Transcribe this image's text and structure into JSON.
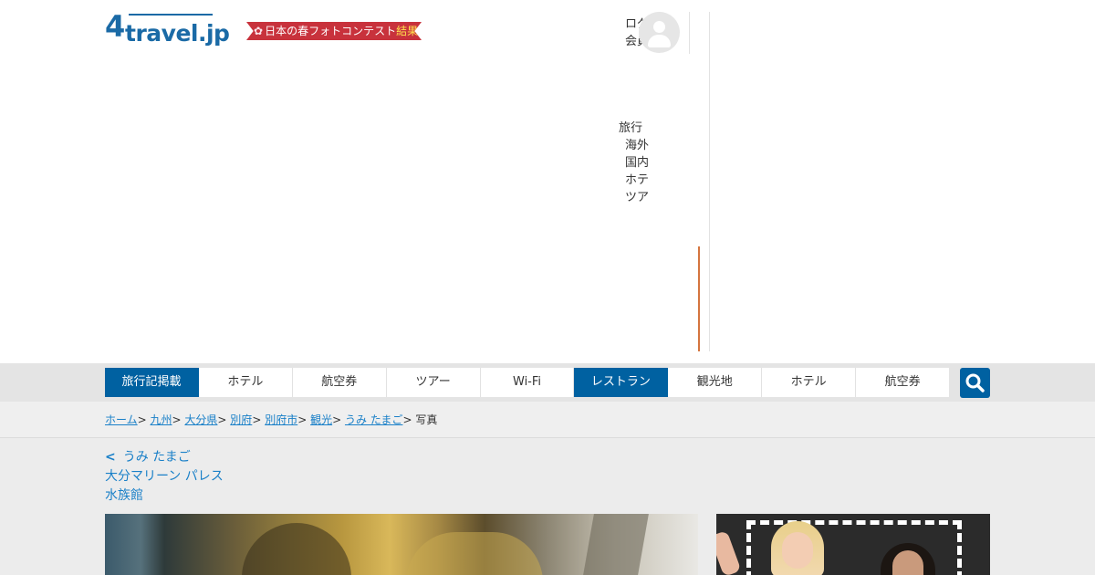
{
  "header": {
    "logo_number": "4",
    "logo_text": "travel.jp",
    "banner": {
      "prefix": "日本の春フォトコンテスト",
      "highlight": "結果発表"
    },
    "user_links": [
      "ログ",
      "会員"
    ],
    "menu": {
      "heading": "旅行",
      "items": [
        "海外",
        "国内",
        "ホテ",
        "ツア"
      ]
    }
  },
  "nav": {
    "tabs": [
      "旅行記掲載",
      "ホテル",
      "航空券",
      "ツアー",
      "Wi-Fi",
      "レストラン",
      "観光地",
      "ホテル",
      "航空券"
    ],
    "active_tabs": [
      0,
      5
    ]
  },
  "breadcrumbs": {
    "links": [
      "ホーム",
      "九州",
      "大分県",
      "別府",
      "別府市",
      "観光",
      "うみ たまご"
    ],
    "current": "写真"
  },
  "main": {
    "back_label": "うみ たまご",
    "title_line1": "大分マリーン パレス",
    "title_line2": "水族館"
  },
  "colors": {
    "primary": "#0061a1",
    "link": "#1a80c8",
    "accent": "#d5753f",
    "banner": "#c8323c"
  }
}
